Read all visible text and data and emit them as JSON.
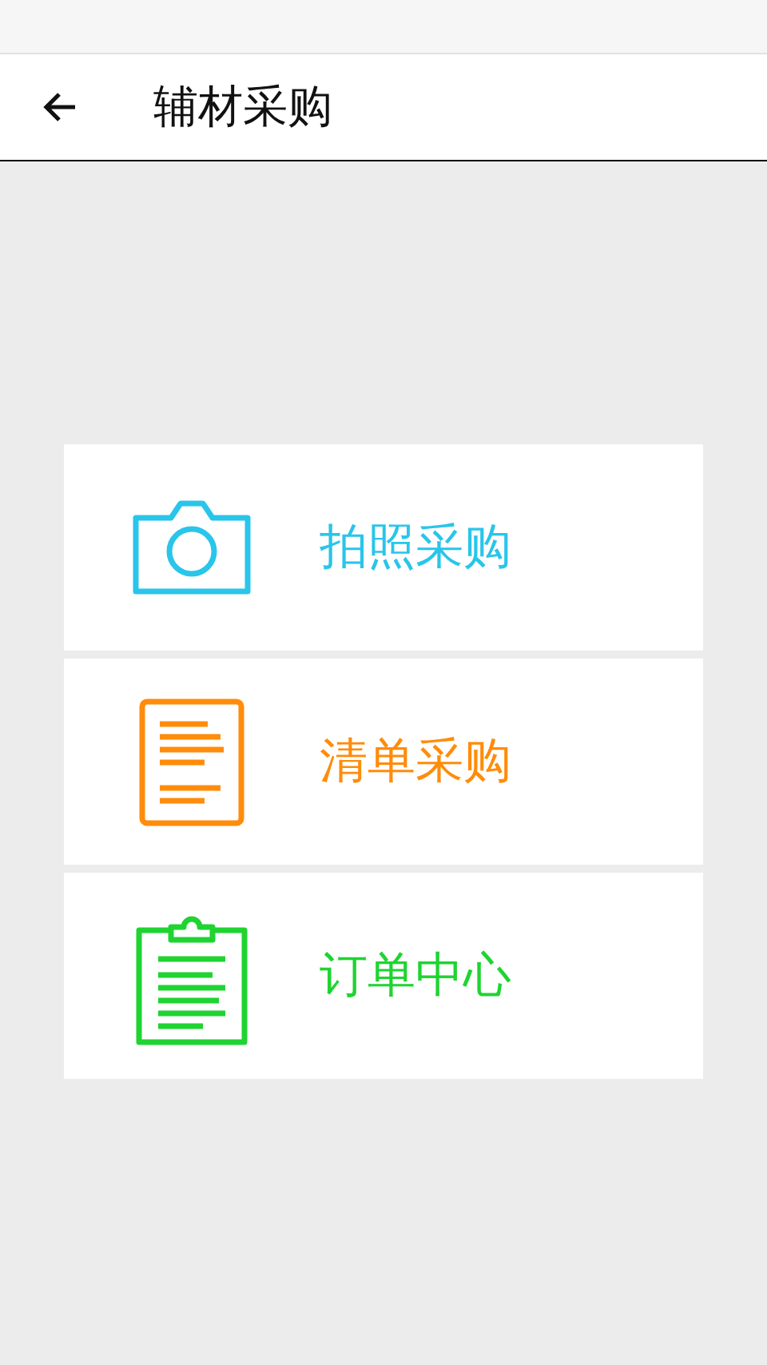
{
  "header": {
    "title": "辅材采购"
  },
  "menu": [
    {
      "kind": "camera",
      "label": "拍照采购",
      "color": "#29c5ea"
    },
    {
      "kind": "list",
      "label": "清单采购",
      "color": "#ff8c0a"
    },
    {
      "kind": "clipboard",
      "label": "订单中心",
      "color": "#1fd431"
    }
  ]
}
